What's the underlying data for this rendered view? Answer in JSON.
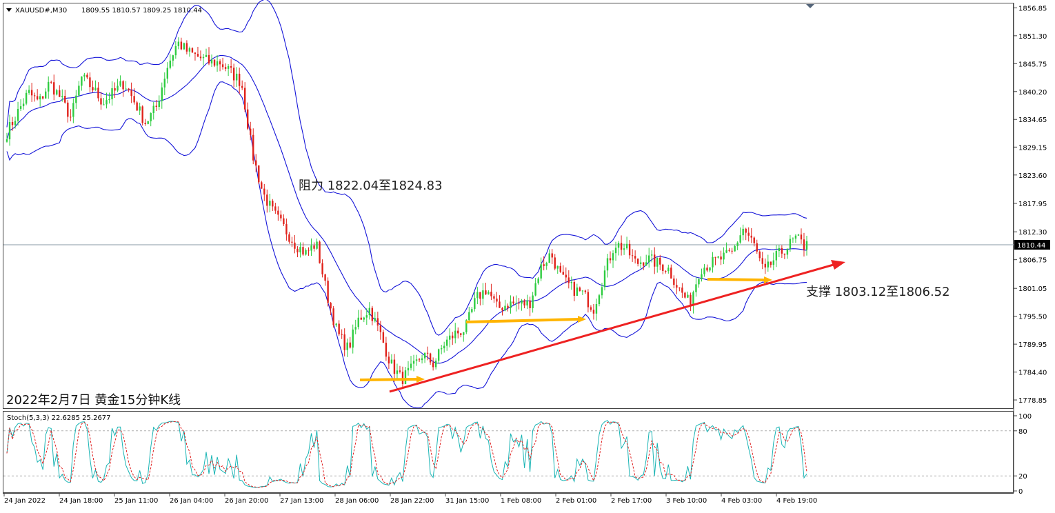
{
  "header": {
    "symbol": "XAUUSD#,M30",
    "ohlc": "1809.55 1810.57 1809.25 1810.44"
  },
  "annotations": {
    "resistance": "阻力 1822.04至1824.83",
    "support": "支撑 1803.12至1806.52",
    "caption": "2022年2月7日 黄金15分钟K线"
  },
  "indicator": {
    "label": "Stoch(5,3,3) 22.6285 25.2677",
    "levels": [
      80,
      20
    ],
    "axis_ticks": [
      "100",
      "80",
      "20",
      "0"
    ]
  },
  "colors": {
    "bull": "#2ecc40",
    "bear": "#e0221b",
    "bands": "#1414d8",
    "trendline": "#ee2222",
    "support_lines": "#ffb400",
    "stoch_main": "#18b4b4",
    "stoch_signal": "#e02020",
    "current_price_line": "#8a9aa6"
  },
  "chart_data": {
    "type": "candlestick",
    "instrument": "XAUUSD#",
    "timeframe": "M30",
    "current_price": 1810.44,
    "price_range": [
      1776.8,
      1858.0
    ],
    "price_ticks": [
      "1856.85",
      "1851.30",
      "1845.75",
      "1840.20",
      "1834.65",
      "1829.15",
      "1823.60",
      "1817.95",
      "1812.30",
      "1806.75",
      "1801.05",
      "1795.50",
      "1789.95",
      "1784.40",
      "1778.85"
    ],
    "time_labels": [
      "24 Jan 2022",
      "24 Jan 18:00",
      "25 Jan 11:00",
      "26 Jan 04:00",
      "26 Jan 20:00",
      "27 Jan 13:00",
      "28 Jan 06:00",
      "28 Jan 22:00",
      "31 Jan 15:00",
      "1 Feb 08:00",
      "2 Feb 01:00",
      "2 Feb 17:00",
      "3 Feb 10:00",
      "4 Feb 03:00",
      "4 Feb 19:00"
    ],
    "close_path": [
      1832,
      1836,
      1840,
      1838,
      1842,
      1839,
      1835,
      1843,
      1841,
      1838,
      1840,
      1842,
      1838,
      1834,
      1837,
      1845,
      1850,
      1848,
      1847,
      1846,
      1846,
      1844,
      1842,
      1828,
      1820,
      1816,
      1813,
      1810,
      1808,
      1810,
      1800,
      1792,
      1789,
      1795,
      1797,
      1792,
      1786,
      1783,
      1785,
      1788,
      1786,
      1790,
      1792,
      1793,
      1799,
      1801,
      1797,
      1798,
      1798,
      1798,
      1805,
      1808,
      1803,
      1801,
      1800,
      1797,
      1804,
      1810,
      1809,
      1806,
      1807,
      1806,
      1805,
      1801,
      1798,
      1805,
      1806,
      1807,
      1808,
      1813,
      1810,
      1804,
      1807,
      1809,
      1811,
      1809
    ],
    "trendline": {
      "from": [
        "28 Jan 06:00",
        1781.5
      ],
      "to": [
        "4 Feb 19:00",
        1807.0
      ]
    },
    "support_segments": [
      {
        "price": 1785.0
      },
      {
        "price": 1796.5
      },
      {
        "price": 1804.0
      }
    ],
    "stochastic": {
      "k": 22.6285,
      "d": 25.2677,
      "overbought": 80,
      "oversold": 20
    }
  }
}
